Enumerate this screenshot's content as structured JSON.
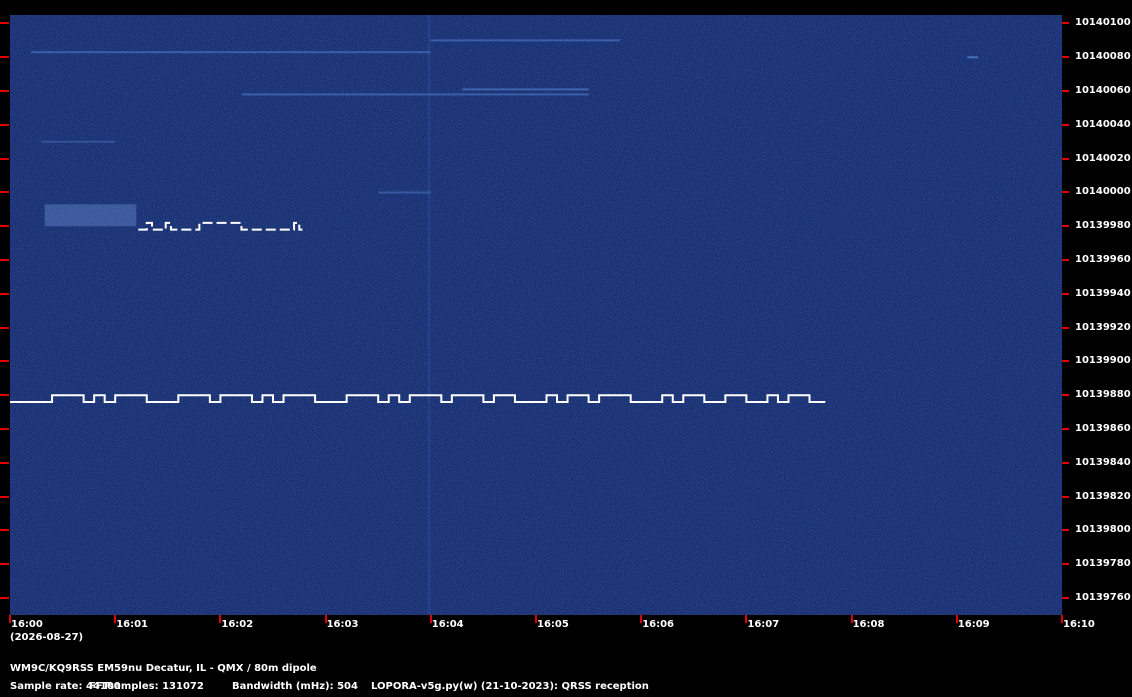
{
  "colors": {
    "background": "#000000",
    "waterfall": "#0a1a4a",
    "tick": "#e00000",
    "trace": "#ffffff"
  },
  "chart_data": {
    "type": "heatmap",
    "x_tick_labels": [
      "16:00",
      "16:01",
      "16:02",
      "16:03",
      "16:04",
      "16:05",
      "16:06",
      "16:07",
      "16:08",
      "16:09",
      "16:10"
    ],
    "y_tick_labels": [
      "10140100",
      "10140080",
      "10140060",
      "10140040",
      "10140020",
      "10140000",
      "10139980",
      "10139960",
      "10139940",
      "10139920",
      "10139900",
      "10139880",
      "10139860",
      "10139840",
      "10139820",
      "10139800",
      "10139780",
      "10139760"
    ],
    "x_range_minutes": [
      0,
      10
    ],
    "y_range_hz": [
      10139750,
      10140105
    ],
    "fsk_trace_main": {
      "base_hz": 10139876,
      "high_hz": 10139880,
      "end_minute": 7.75,
      "high_segments_minutes": [
        [
          0.4,
          0.7
        ],
        [
          0.8,
          0.9
        ],
        [
          1.0,
          1.3
        ],
        [
          1.6,
          1.9
        ],
        [
          2.0,
          2.3
        ],
        [
          2.4,
          2.5
        ],
        [
          2.6,
          2.9
        ],
        [
          3.2,
          3.5
        ],
        [
          3.6,
          3.7
        ],
        [
          3.8,
          4.1
        ],
        [
          4.2,
          4.5
        ],
        [
          4.6,
          4.8
        ],
        [
          5.1,
          5.2
        ],
        [
          5.3,
          5.5
        ],
        [
          5.6,
          5.9
        ],
        [
          6.2,
          6.3
        ],
        [
          6.4,
          6.6
        ],
        [
          6.8,
          7.0
        ],
        [
          7.2,
          7.3
        ],
        [
          7.4,
          7.6
        ]
      ]
    },
    "fsk_trace_upper": {
      "base_hz": 10139978,
      "high_hz": 10139982,
      "start_minute": 1.22,
      "end_minute": 2.78,
      "high_segments_minutes": [
        [
          1.3,
          1.35
        ],
        [
          1.48,
          1.53
        ],
        [
          1.8,
          2.2
        ],
        [
          2.7,
          2.75
        ]
      ]
    }
  },
  "date_label": "(2026-08-27)",
  "footer": {
    "station": "WM9C/KQ9RSS EM59nu Decatur, IL - QMX / 80m dipole",
    "sample_rate": "Sample rate: 44100",
    "fft_samples": "FFTsamples: 131072",
    "bandwidth": "Bandwidth (mHz): 504",
    "software": "LOPORA-v5g.py(w) (21-10-2023): QRSS reception"
  }
}
